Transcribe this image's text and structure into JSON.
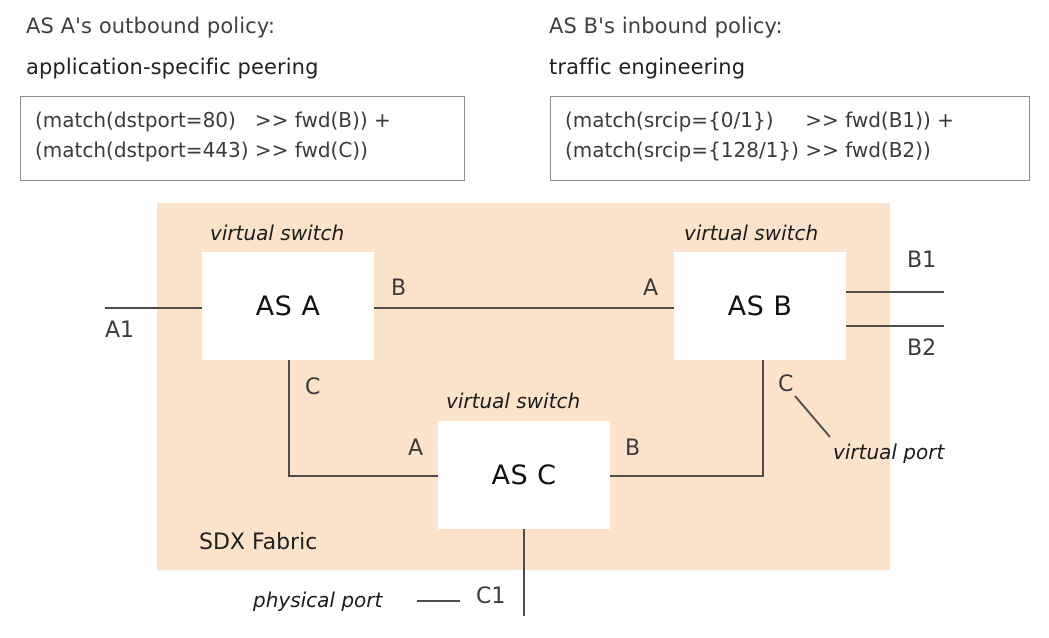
{
  "policies": [
    {
      "title": "AS A's outbound policy:",
      "subtitle": "application-specific peering",
      "code_line_1": "(match(dstport=80)   >> fwd(B)) +",
      "code_line_2": "(match(dstport=443) >> fwd(C))"
    },
    {
      "title": "AS B's inbound policy:",
      "subtitle": "traffic engineering",
      "code_line_1": "(match(srcip={0/1})     >> fwd(B1)) +",
      "code_line_2": "(match(srcip={128/1}) >> fwd(B2))"
    }
  ],
  "fabric": {
    "label": "SDX Fabric",
    "color": "#fbe2cb"
  },
  "switches": [
    {
      "name": "AS A",
      "caption": "virtual switch"
    },
    {
      "name": "AS B",
      "caption": "virtual switch"
    },
    {
      "name": "AS C",
      "caption": "virtual switch"
    }
  ],
  "ports": {
    "a1": "A1",
    "a_to_b": "B",
    "a_to_c": "C",
    "b_from_a": "A",
    "b_to_c": "C",
    "b1": "B1",
    "b2": "B2",
    "c_from_a": "A",
    "c_from_b": "B",
    "c1": "C1"
  },
  "callouts": {
    "virtual_port": "virtual port",
    "physical_port": "physical port"
  },
  "colors": {
    "fabric": "#fbe2cb",
    "wire": "#4d4d4d",
    "box_border": "#8e8e8e",
    "text": "#3a3a3a"
  }
}
